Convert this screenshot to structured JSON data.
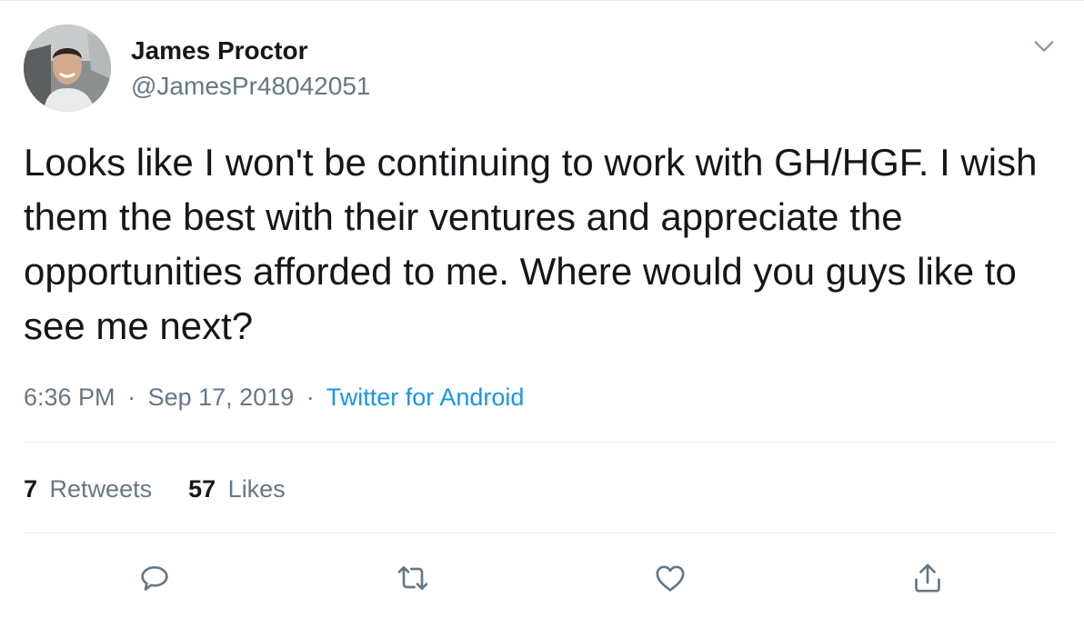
{
  "author": {
    "display_name": "James Proctor",
    "handle": "@JamesPr48042051"
  },
  "tweet": {
    "text": "Looks like I won't be continuing to work with GH/HGF. I wish them the best with their ventures and appreciate the opportunities afforded to me. Where would you guys like to see me next?",
    "time": "6:36 PM",
    "date": "Sep 17, 2019",
    "separator": "·",
    "source": "Twitter for Android"
  },
  "stats": {
    "retweets_count": "7",
    "retweets_label": "Retweets",
    "likes_count": "57",
    "likes_label": "Likes"
  },
  "icons": {
    "caret": "chevron-down-icon",
    "reply": "reply-icon",
    "retweet": "retweet-icon",
    "like": "heart-icon",
    "share": "share-icon"
  },
  "colors": {
    "text": "#14171a",
    "secondary": "#657786",
    "link": "#1b95e0",
    "divider": "#e6ecf0"
  }
}
